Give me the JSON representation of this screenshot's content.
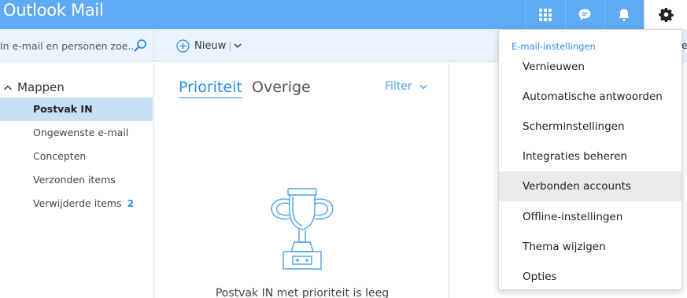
{
  "app": {
    "title": "Outlook Mail"
  },
  "topbar": {
    "buttons": [
      {
        "icon": "app-launcher-grid-icon"
      },
      {
        "icon": "chat-bubble-icon"
      },
      {
        "icon": "bell-icon"
      },
      {
        "icon": "gear-icon",
        "active": true
      }
    ]
  },
  "search": {
    "placeholder": "In e-mail en personen zoe..."
  },
  "toolbar": {
    "new_label": "Nieuw",
    "separator": "|",
    "truncated_text": "e"
  },
  "sidebar": {
    "folders_label": "Mappen",
    "items": [
      {
        "label": "Postvak IN",
        "selected": true,
        "count": ""
      },
      {
        "label": "Ongewenste e-mail",
        "selected": false,
        "count": ""
      },
      {
        "label": "Concepten",
        "selected": false,
        "count": ""
      },
      {
        "label": "Verzonden items",
        "selected": false,
        "count": ""
      },
      {
        "label": "Verwijderde items",
        "selected": false,
        "count": "2"
      }
    ]
  },
  "msglist": {
    "tab_focused": "Prioriteit",
    "tab_other": "Overige",
    "filter_label": "Filter",
    "empty_text": "Postvak IN met prioriteit is leeg"
  },
  "settings_menu": {
    "header": "E-mail-instellingen",
    "items": [
      "Vernieuwen",
      "Automatische antwoorden",
      "Scherminstellingen",
      "Integraties beheren",
      "Verbonden accounts",
      "Offline-instellingen",
      "Thema wijzigen",
      "Opties"
    ],
    "hovered_item": "Verbonden accounts"
  },
  "colors": {
    "brand": "#5eaaf4",
    "accent": "#2d8ee8",
    "selected_folder": "#c7e0f8",
    "command_bar": "#eaf3fd"
  }
}
